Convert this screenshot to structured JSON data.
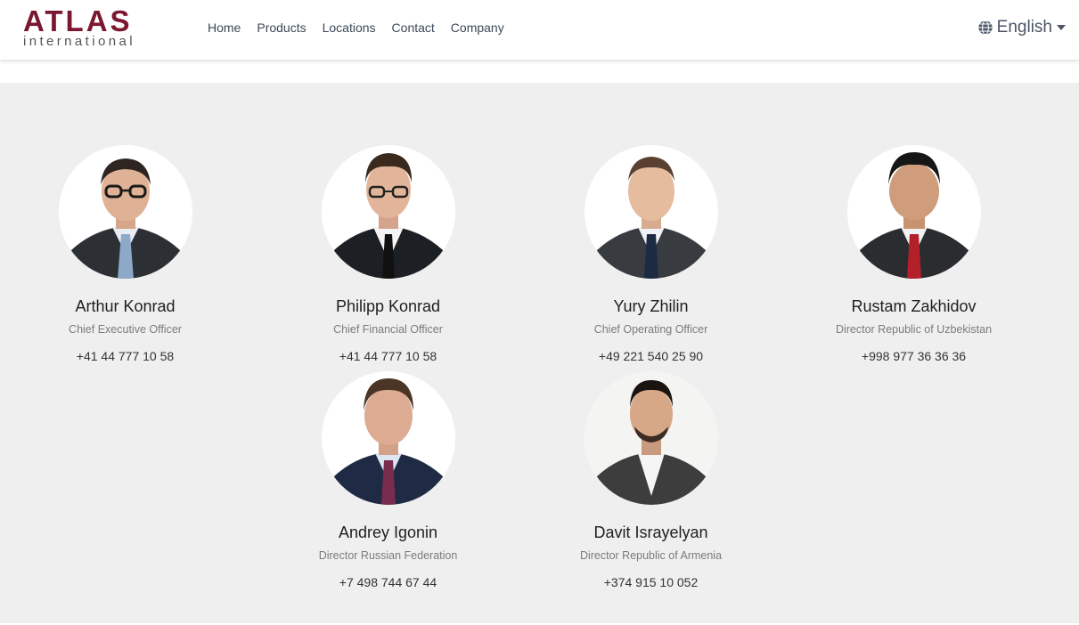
{
  "brand": {
    "name": "ATLAS",
    "tagline": "international",
    "color": "#7a1830"
  },
  "nav": {
    "links": [
      "Home",
      "Products",
      "Locations",
      "Contact",
      "Company"
    ],
    "language": {
      "label": "English",
      "icon": "globe-icon"
    }
  },
  "team": [
    {
      "name": "Arthur Konrad",
      "role": "Chief Executive Officer",
      "phone": "+41 44 777 10 58"
    },
    {
      "name": "Philipp Konrad",
      "role": "Chief Financial Officer",
      "phone": "+41 44 777 10 58"
    },
    {
      "name": "Yury Zhilin",
      "role": "Chief Operating Officer",
      "phone": "+49 221 540 25 90"
    },
    {
      "name": "Rustam Zakhidov",
      "role": "Director Republic of Uzbekistan",
      "phone": "+998 977 36 36 36"
    },
    {
      "name": "Andrey Igonin",
      "role": "Director Russian Federation",
      "phone": "+7 498 744 67 44"
    },
    {
      "name": "Davit Israyelyan",
      "role": "Director Republic of Armenia",
      "phone": "+374 915 10 052"
    }
  ]
}
